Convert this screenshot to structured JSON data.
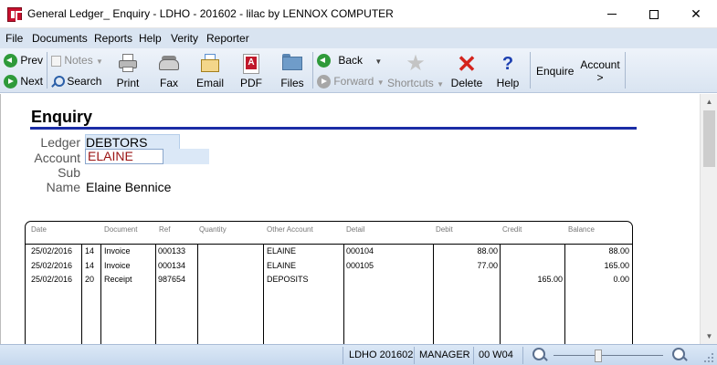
{
  "window": {
    "title": "General Ledger_ Enquiry - LDHO - 201602 - lilac by LENNOX COMPUTER",
    "controls": {
      "minimize": "—",
      "maximize": "☐",
      "close": "✕"
    }
  },
  "menu": {
    "items": [
      "File",
      "Documents",
      "Reports",
      "Help",
      "Verity",
      "Reporter"
    ]
  },
  "toolbar": {
    "prev": "Prev",
    "next": "Next",
    "notes": "Notes",
    "search": "Search",
    "print": "Print",
    "fax": "Fax",
    "email": "Email",
    "pdf": "PDF",
    "files": "Files",
    "back": "Back",
    "forward": "Forward",
    "shortcuts": "Shortcuts",
    "delete": "Delete",
    "help": "Help",
    "enquire": "Enquire",
    "account": "Account",
    "account_arrow": ">"
  },
  "enquiry": {
    "title": "Enquiry",
    "ledger_label": "Ledger",
    "ledger_value": "DEBTORS",
    "account_label": "Account",
    "account_value": "ELAINE",
    "sub_label": "Sub",
    "sub_value": "",
    "name_label": "Name",
    "name_value": "Elaine Bennice"
  },
  "grid": {
    "headers": {
      "date": "Date",
      "doc_no": "",
      "document": "Document",
      "ref": "Ref",
      "quantity": "Quantity",
      "other_account": "Other Account",
      "detail": "Detail",
      "debit": "Debit",
      "credit": "Credit",
      "balance": "Balance"
    },
    "rows": [
      {
        "date": "25/02/2016",
        "doc_no": "14",
        "document": "Invoice",
        "ref": "000133",
        "quantity": "",
        "other_account": "ELAINE",
        "detail": "000104",
        "debit": "88.00",
        "credit": "",
        "balance": "88.00"
      },
      {
        "date": "25/02/2016",
        "doc_no": "14",
        "document": "Invoice",
        "ref": "000134",
        "quantity": "",
        "other_account": "ELAINE",
        "detail": "000105",
        "debit": "77.00",
        "credit": "",
        "balance": "165.00"
      },
      {
        "date": "25/02/2016",
        "doc_no": "20",
        "document": "Receipt",
        "ref": "987654",
        "quantity": "",
        "other_account": "DEPOSITS",
        "detail": "",
        "debit": "",
        "credit": "165.00",
        "balance": "0.00"
      }
    ]
  },
  "statusbar": {
    "company_period": "LDHO 201602",
    "user": "MANAGER",
    "workstation": "00 W04"
  },
  "icons": {
    "app": "lennox-logo-icon",
    "prev": "arrow-left-circle-icon",
    "next": "arrow-right-circle-icon",
    "notes": "notes-icon",
    "search": "magnifier-icon",
    "print": "printer-icon",
    "fax": "fax-icon",
    "email": "email-icon",
    "pdf": "pdf-icon",
    "files": "folder-icon",
    "shortcuts": "star-icon",
    "delete": "delete-x-icon",
    "help": "question-icon"
  },
  "colors": {
    "menubar": "#d9e4f1",
    "title_rule": "#1b2da6",
    "account_text": "#9a1313",
    "delete_icon": "#d4241d",
    "nav_icon": "#2f9a3a"
  }
}
